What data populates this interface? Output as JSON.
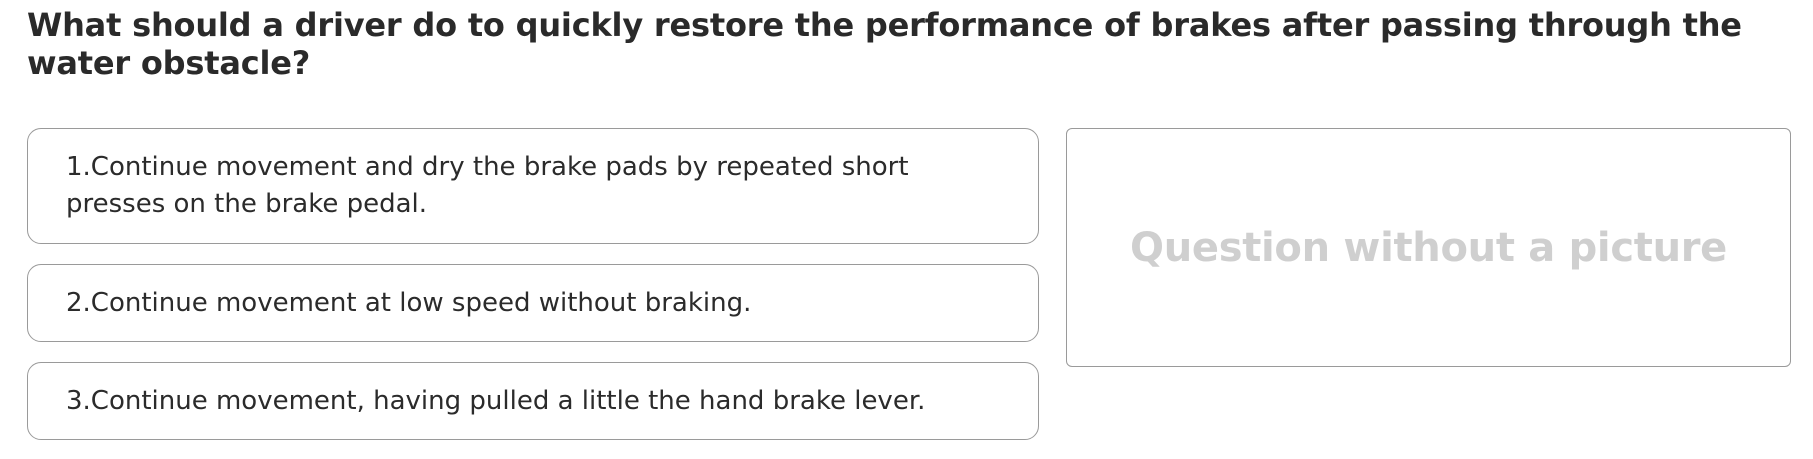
{
  "question": {
    "text": "What should a driver do to quickly restore the performance of brakes after passing through the water obstacle?"
  },
  "answers": [
    {
      "label": "1.Continue movement and dry the brake pads by repeated short presses on the brake pedal."
    },
    {
      "label": "2.Continue movement at low speed without braking."
    },
    {
      "label": "3.Continue movement, having pulled a little the hand brake lever."
    }
  ],
  "picture": {
    "placeholder": "Question without a picture"
  },
  "colors": {
    "text": "#2b2b2b",
    "border": "#9a9a9a",
    "placeholder": "#cfcfcf",
    "background": "#ffffff"
  }
}
